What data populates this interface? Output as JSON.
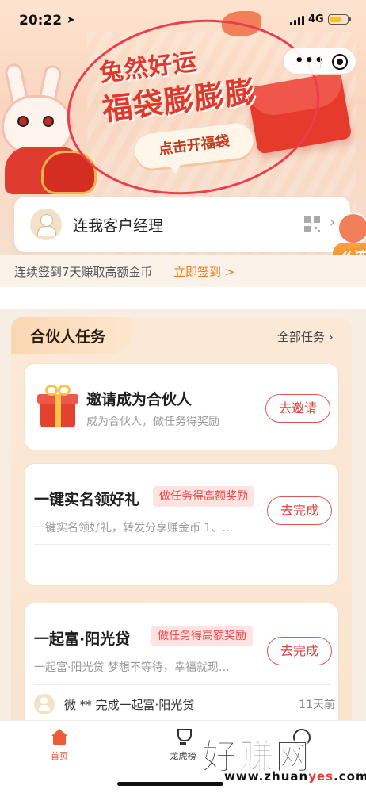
{
  "status_bar": {
    "time": "20:22",
    "network": "4G",
    "location_icon": "location-arrow-icon",
    "battery_color": "#f6c31c"
  },
  "capsule": {
    "more_label": "•••",
    "more_icon": "more-dots-icon",
    "close_icon": "close-target-icon"
  },
  "banner": {
    "title_line1": "兔然好运",
    "title_line2": "福袋膨膨膨",
    "button_label": "点击开福袋",
    "accent_color": "#e0382a"
  },
  "manager": {
    "label": "连我客户经理",
    "avatar_icon": "manager-avatar-icon",
    "qr_icon": "qr-code-icon",
    "chevron": "›"
  },
  "side_tag": {
    "text": "“连课"
  },
  "signin": {
    "text": "连续签到7天赚取高额金币",
    "link": "立即签到 >"
  },
  "task_panel": {
    "tab_title": "合伙人任务",
    "all_tasks": "全部任务 ›",
    "tasks": [
      {
        "title": "邀请成为合伙人",
        "subtitle": "成为合伙人，做任务得奖励",
        "button": "去邀请",
        "icon": "gift-box-icon"
      },
      {
        "title": "一键实名领好礼",
        "badge": "做任务得高额奖励",
        "subtitle": "一键实名领好礼，转发分享赚金币 1、…",
        "button": "去完成"
      },
      {
        "title": "一起富·阳光贷",
        "badge": "做任务得高额奖励",
        "subtitle": "一起富·阳光贷 梦想不等待，幸福就现…",
        "button": "去完成",
        "feed": {
          "text": "微 ** 完成一起富·阳光贷",
          "time": "11天前"
        }
      }
    ]
  },
  "tabbar": {
    "tabs": [
      {
        "label": "首页",
        "icon": "home-icon",
        "active": true
      },
      {
        "label": "龙虎榜",
        "icon": "trophy-icon",
        "active": false
      },
      {
        "label": "",
        "icon": "tab-circle-icon",
        "active": false
      }
    ],
    "active_color": "#ec5a33"
  },
  "watermark": {
    "main": "好赚网",
    "sub_prefix": "www.zhuan",
    "sub_highlight": "yes",
    "sub_suffix": ".com"
  }
}
